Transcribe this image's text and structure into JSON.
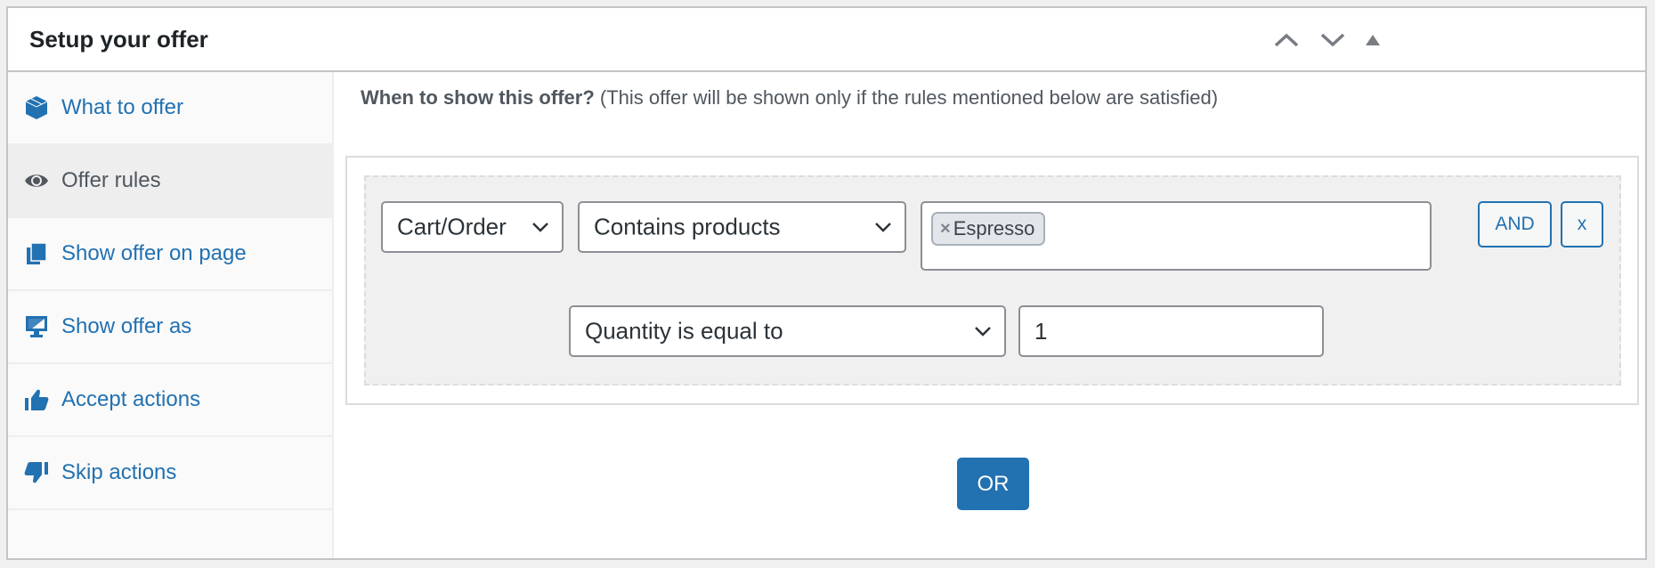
{
  "header": {
    "title": "Setup your offer",
    "controls": [
      "move-up",
      "move-down",
      "toggle-panel"
    ]
  },
  "sidebar": {
    "items": [
      {
        "label": "What to offer",
        "icon": "cube-icon",
        "active": false
      },
      {
        "label": "Offer rules",
        "icon": "eye-icon",
        "active": true
      },
      {
        "label": "Show offer on page",
        "icon": "pages-icon",
        "active": false
      },
      {
        "label": "Show offer as",
        "icon": "desktop-icon",
        "active": false
      },
      {
        "label": "Accept actions",
        "icon": "thumbs-up-icon",
        "active": false
      },
      {
        "label": "Skip actions",
        "icon": "thumbs-down-icon",
        "active": false
      }
    ]
  },
  "main": {
    "question": "When to show this offer?",
    "hint": "(This offer will be shown only if the rules mentioned below are satisfied)",
    "rule": {
      "subject": "Cart/Order",
      "condition": "Contains products",
      "products": [
        "Espresso"
      ],
      "tag_remove": "×",
      "quantity_condition": "Quantity is equal to",
      "quantity_value": "1",
      "and_label": "AND",
      "remove_label": "x"
    },
    "or_label": "OR"
  },
  "colors": {
    "accent": "#2271b1",
    "text": "#1d2327",
    "muted_text": "#50575e",
    "border": "#c3c4c7"
  }
}
